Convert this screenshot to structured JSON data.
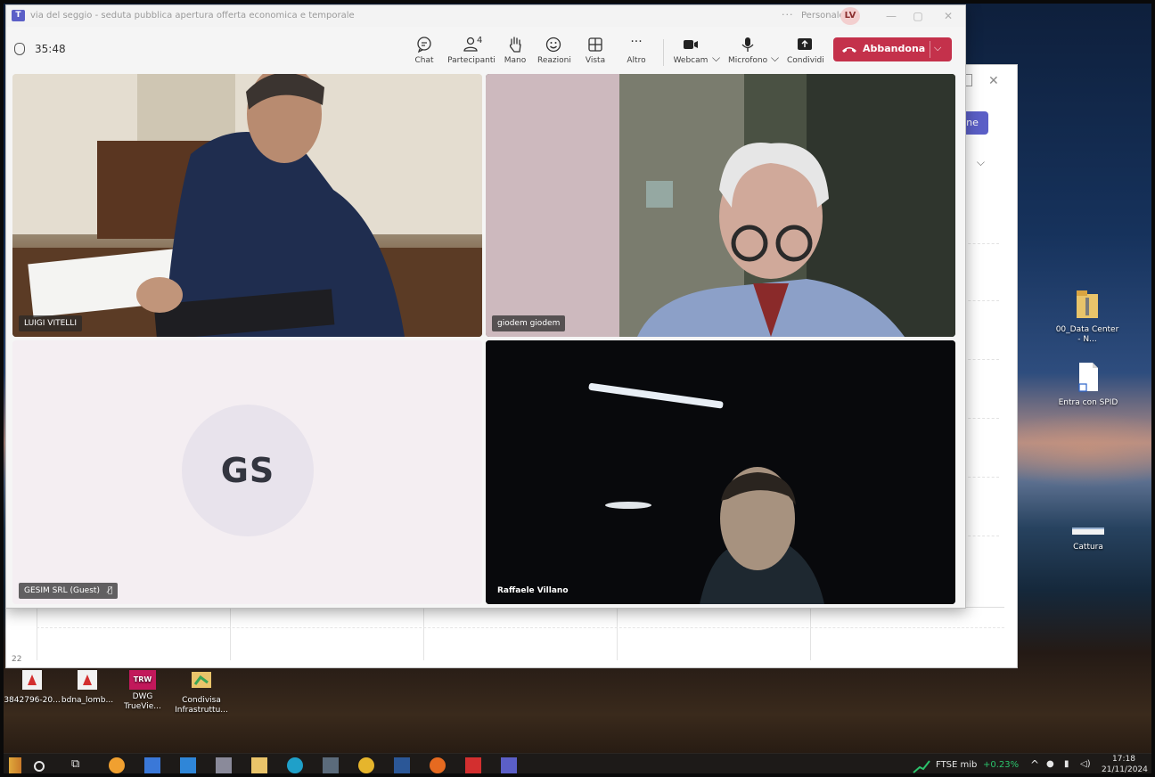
{
  "teams_window": {
    "title": "via del seggio - seduta pubblica apertura offerta economica e temporale",
    "more_label": "···",
    "profile_label": "Personale",
    "avatar_initials": "LV",
    "timer": "35:48"
  },
  "toolbar": {
    "chat": "Chat",
    "participants": "Partecipanti",
    "participants_count": "4",
    "raise_hand": "Mano",
    "reactions": "Reazioni",
    "view": "Vista",
    "more": "Altro",
    "more_glyph": "···",
    "webcam": "Webcam",
    "microphone": "Microfono",
    "share": "Condividi",
    "leave": "Abbandona"
  },
  "participants": [
    {
      "name": "LUIGI VITELLI"
    },
    {
      "name": "giodem giodem"
    },
    {
      "name": "GESIM SRL (Guest)",
      "initials": "GS",
      "muted": true
    },
    {
      "name": "Raffaele Villano"
    }
  ],
  "background_window": {
    "button_label": "ne",
    "row_label": "22"
  },
  "desktop_icons": [
    {
      "label": "3842796-20..."
    },
    {
      "label": "bdna_lomb..."
    },
    {
      "label": "DWG TrueVie...",
      "badge": "TRW"
    },
    {
      "label": "Condivisa Infrastruttu..."
    },
    {
      "label": "00_Data Center - N..."
    },
    {
      "label": "Entra con SPID"
    },
    {
      "label": "Cattura"
    }
  ],
  "taskbar": {
    "stock_name": "FTSE mib",
    "stock_change": "+0.23%",
    "time": "17:18",
    "date": "21/11/2024"
  },
  "colors": {
    "accent": "#5b5fc7",
    "leave_red": "#c4314b",
    "stock_green": "#2bc26b"
  }
}
